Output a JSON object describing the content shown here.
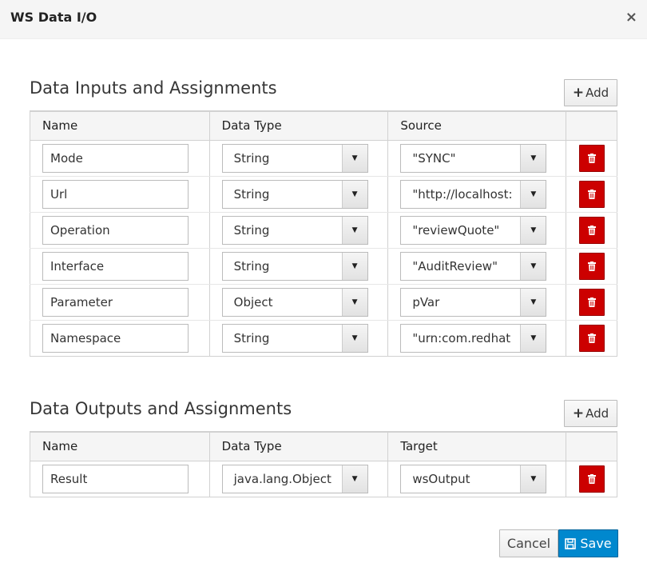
{
  "dialog": {
    "title": "WS Data I/O",
    "close": "×"
  },
  "inputs": {
    "heading": "Data Inputs and Assignments",
    "add_label": "Add",
    "columns": [
      "Name",
      "Data Type",
      "Source",
      ""
    ],
    "rows": [
      {
        "name": "Mode",
        "type": "String",
        "source": "\"SYNC\""
      },
      {
        "name": "Url",
        "type": "String",
        "source": "\"http://localhost:"
      },
      {
        "name": "Operation",
        "type": "String",
        "source": "\"reviewQuote\""
      },
      {
        "name": "Interface",
        "type": "String",
        "source": "\"AuditReview\""
      },
      {
        "name": "Parameter",
        "type": "Object",
        "source": "pVar"
      },
      {
        "name": "Namespace",
        "type": "String",
        "source": "\"urn:com.redhat"
      }
    ]
  },
  "outputs": {
    "heading": "Data Outputs and Assignments",
    "add_label": "Add",
    "columns": [
      "Name",
      "Data Type",
      "Target",
      ""
    ],
    "rows": [
      {
        "name": "Result",
        "type": "java.lang.Object",
        "target": "wsOutput"
      }
    ]
  },
  "footer": {
    "cancel": "Cancel",
    "save": "Save"
  },
  "colors": {
    "danger": "#cc0000",
    "primary": "#0088ce"
  }
}
